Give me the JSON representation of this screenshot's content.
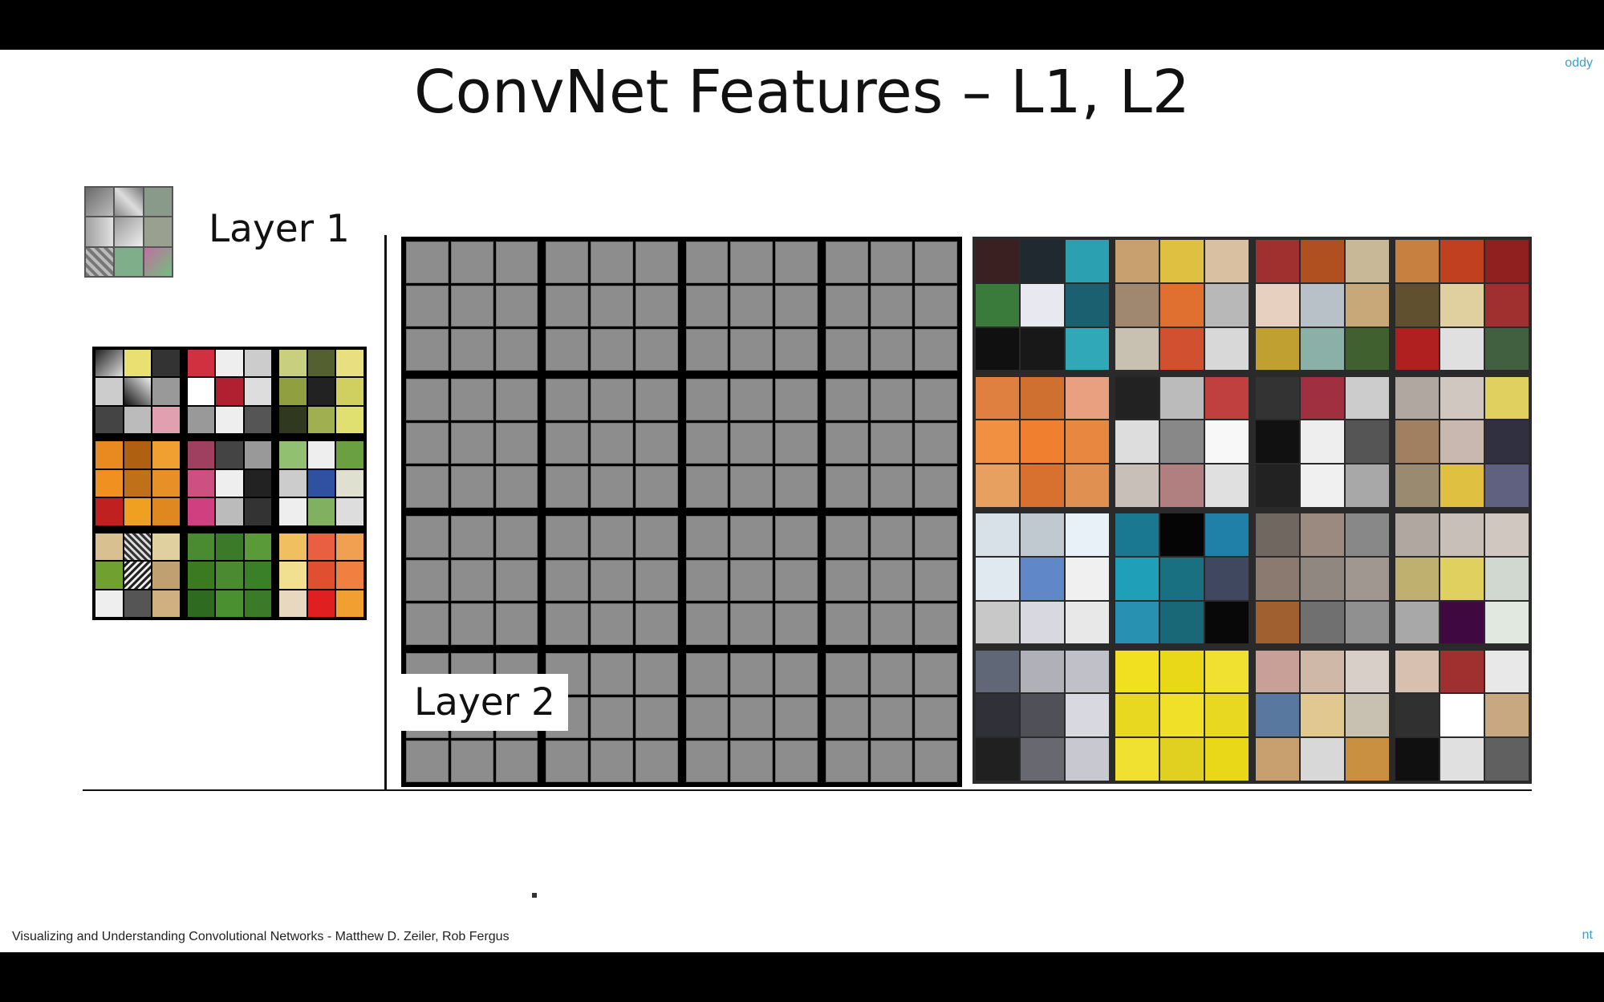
{
  "slide": {
    "title": "ConvNet Features – L1, L2",
    "corner_top_right": "oddy",
    "corner_bottom_right": "nt",
    "caption": "Visualizing and Understanding Convolutional Networks - Matthew D. Zeiler, Rob Fergus"
  },
  "layer1": {
    "label": "Layer 1"
  },
  "layer2": {
    "label": "Layer 2"
  },
  "colors": {
    "background": "#ffffff",
    "frame": "#000000",
    "accent": "#3aa0c8",
    "filter_gray": "#8d8d8d"
  }
}
